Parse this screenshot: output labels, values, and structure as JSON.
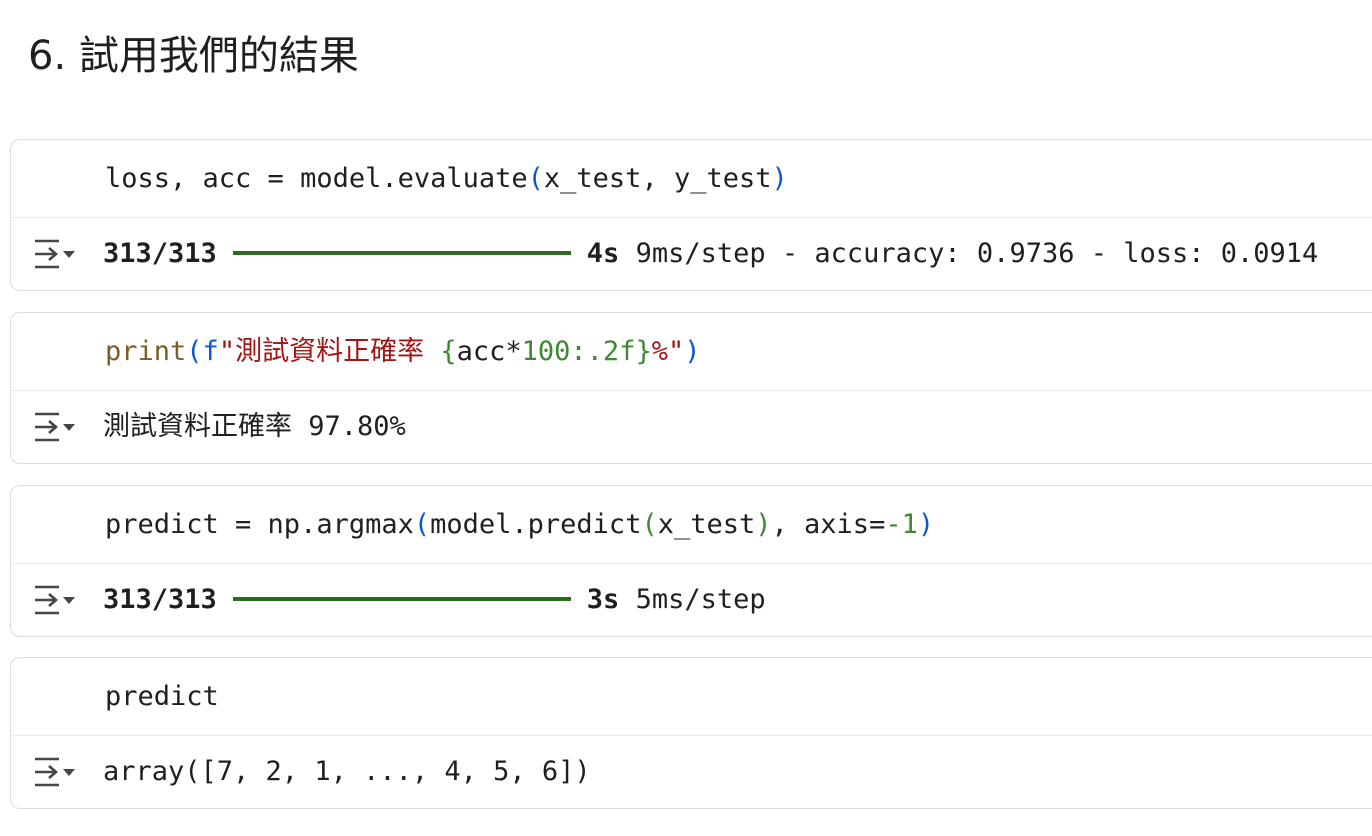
{
  "heading": "6. 試用我們的結果",
  "cells": [
    {
      "code": {
        "part1": "loss, acc = model.evaluate",
        "lparen": "(",
        "args": "x_test, y_test",
        "rparen": ")"
      },
      "output": {
        "steps": "313/313",
        "time": "4s",
        "rest": " 9ms/step - accuracy: 0.9736 - loss: 0.0914"
      }
    },
    {
      "code": {
        "func": "print",
        "lparen": "(",
        "fprefix": "f",
        "str_open": "\"測試資料正確率 ",
        "lbrace": "{",
        "expr_var": "acc",
        "expr_op": "*",
        "expr_num": "100",
        "expr_fmt": ":.2f",
        "rbrace": "}",
        "str_close": "%\"",
        "rparen": ")"
      },
      "output": {
        "text": "測試資料正確率 97.80%"
      }
    },
    {
      "code": {
        "part1": "predict = np.argmax",
        "lparen1": "(",
        "part2": "model.predict",
        "lparen2": "(",
        "arg": "x_test",
        "rparen2": ")",
        "part3": ", axis=",
        "neg": "-1",
        "rparen1": ")"
      },
      "output": {
        "steps": "313/313",
        "time": "3s",
        "rest": " 5ms/step"
      }
    },
    {
      "code": {
        "text": "predict"
      },
      "output": {
        "text": "array([7, 2, 1, ..., 4, 5, 6])"
      }
    }
  ],
  "icons": {
    "output_toggle": "output-collapse-icon"
  },
  "colors": {
    "progress_bar": "#2c6c1f",
    "bracket_blue": "#0b57d0",
    "bracket_green": "#3d8a33",
    "string": "#a31515",
    "function": "#795e26"
  }
}
